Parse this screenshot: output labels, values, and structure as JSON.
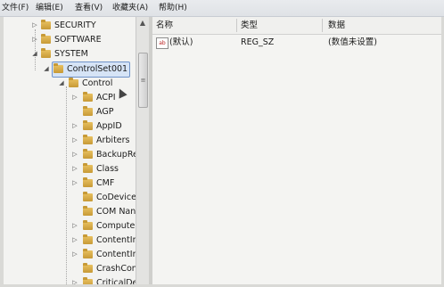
{
  "menubar": {
    "items": [
      "文件(F)",
      "编辑(E)",
      "查看(V)",
      "收藏夹(A)",
      "帮助(H)"
    ]
  },
  "tree": {
    "nodes": [
      {
        "label": "SECURITY"
      },
      {
        "label": "SOFTWARE"
      },
      {
        "label": "SYSTEM"
      },
      {
        "label": "ControlSet001"
      },
      {
        "label": "Control"
      },
      {
        "label": "ACPI"
      },
      {
        "label": "AGP"
      },
      {
        "label": "AppID"
      },
      {
        "label": "Arbiters"
      },
      {
        "label": "BackupRe"
      },
      {
        "label": "Class"
      },
      {
        "label": "CMF"
      },
      {
        "label": "CoDeviceI"
      },
      {
        "label": "COM Nan"
      },
      {
        "label": "Computer"
      },
      {
        "label": "ContentIn"
      },
      {
        "label": "ContentIn"
      },
      {
        "label": "CrashCon"
      },
      {
        "label": "CriticalDe"
      }
    ],
    "arrows": {
      "expanded": "◢",
      "collapsed": "▷"
    }
  },
  "scrollbar": {
    "up": "▲",
    "thumb": "≡"
  },
  "values": {
    "columns": {
      "name": "名称",
      "type": "类型",
      "data": "数据"
    },
    "rows": [
      {
        "icon": "ab",
        "name": "(默认)",
        "type": "REG_SZ",
        "data": "(数值未设置)"
      }
    ]
  }
}
